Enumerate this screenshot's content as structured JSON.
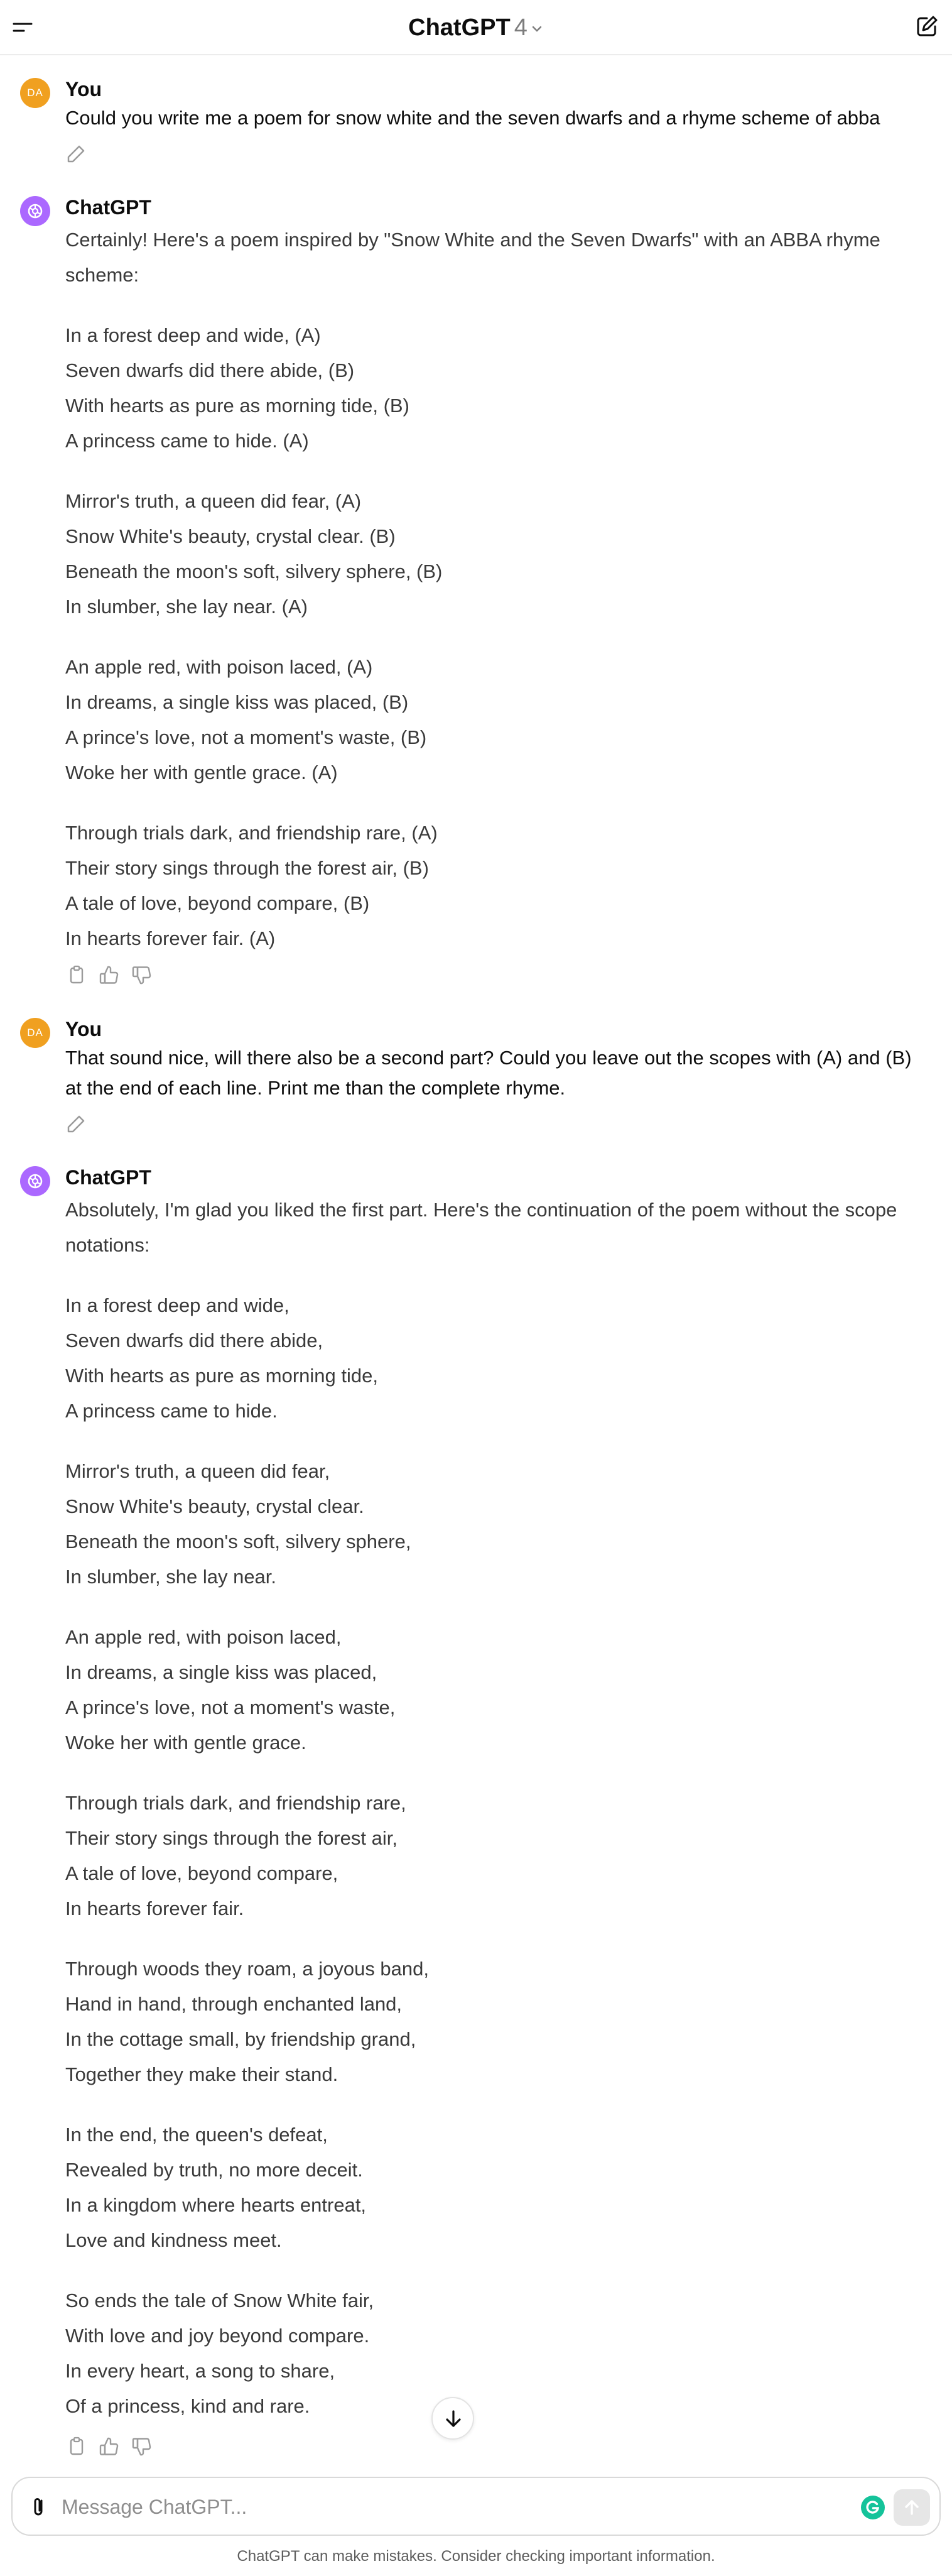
{
  "header": {
    "title": "ChatGPT",
    "version": "4"
  },
  "conversation": [
    {
      "author": "You",
      "avatar_initials": "DA",
      "text": "Could you write me a poem for snow white and the seven dwarfs and a rhyme scheme of abba"
    },
    {
      "author": "ChatGPT",
      "intro": "Certainly! Here's a poem inspired by \"Snow White and the Seven Dwarfs\" with an ABBA rhyme scheme:",
      "stanzas": [
        [
          "In a forest deep and wide, (A)",
          "Seven dwarfs did there abide, (B)",
          "With hearts as pure as morning tide, (B)",
          "A princess came to hide. (A)"
        ],
        [
          "Mirror's truth, a queen did fear, (A)",
          "Snow White's beauty, crystal clear. (B)",
          "Beneath the moon's soft, silvery sphere, (B)",
          "In slumber, she lay near. (A)"
        ],
        [
          "An apple red, with poison laced, (A)",
          "In dreams, a single kiss was placed, (B)",
          "A prince's love, not a moment's waste, (B)",
          "Woke her with gentle grace. (A)"
        ],
        [
          "Through trials dark, and friendship rare, (A)",
          "Their story sings through the forest air, (B)",
          "A tale of love, beyond compare, (B)",
          "In hearts forever fair. (A)"
        ]
      ]
    },
    {
      "author": "You",
      "avatar_initials": "DA",
      "text": "That sound nice, will there also be a second part? Could you leave out the scopes with (A) and (B) at the end of each line. Print me than the complete rhyme."
    },
    {
      "author": "ChatGPT",
      "intro": "Absolutely, I'm glad you liked the first part. Here's the continuation of the poem without the scope notations:",
      "stanzas": [
        [
          "In a forest deep and wide,",
          "Seven dwarfs did there abide,",
          "With hearts as pure as morning tide,",
          "A princess came to hide."
        ],
        [
          "Mirror's truth, a queen did fear,",
          "Snow White's beauty, crystal clear.",
          "Beneath the moon's soft, silvery sphere,",
          "In slumber, she lay near."
        ],
        [
          "An apple red, with poison laced,",
          "In dreams, a single kiss was placed,",
          "A prince's love, not a moment's waste,",
          "Woke her with gentle grace."
        ],
        [
          "Through trials dark, and friendship rare,",
          "Their story sings through the forest air,",
          "A tale of love, beyond compare,",
          "In hearts forever fair."
        ],
        [
          "Through woods they roam, a joyous band,",
          "Hand in hand, through enchanted land,",
          "In the cottage small, by friendship grand,",
          "Together they make their stand."
        ],
        [
          "In the end, the queen's defeat,",
          "Revealed by truth, no more deceit.",
          "In a kingdom where hearts entreat,",
          "Love and kindness meet."
        ],
        [
          "So ends the tale of Snow White fair,",
          "With love and joy beyond compare.",
          "In every heart, a song to share,",
          "Of a princess, kind and rare."
        ]
      ]
    }
  ],
  "composer": {
    "placeholder": "Message ChatGPT..."
  },
  "footer_note": "ChatGPT can make mistakes. Consider checking important information.",
  "icons": {
    "menu": "menu-icon",
    "new_chat": "new-chat-icon",
    "edit": "pencil-icon",
    "copy": "copy-icon",
    "thumbs_up": "thumbs-up-icon",
    "thumbs_down": "thumbs-down-icon",
    "attach": "paperclip-icon",
    "grammarly": "grammarly-icon",
    "send": "arrow-up-icon",
    "scroll_down": "arrow-down-icon"
  },
  "colors": {
    "user_avatar": "#f0a020",
    "assistant_avatar": "#ab68ff",
    "grammarly": "#15c39a"
  }
}
